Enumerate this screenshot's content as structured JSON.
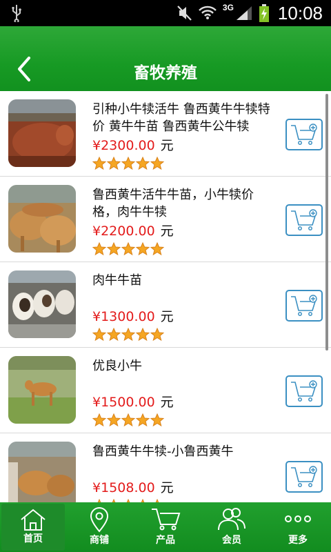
{
  "status_bar": {
    "time": "10:08",
    "network": "3G"
  },
  "header": {
    "title": "畜牧养殖"
  },
  "products": [
    {
      "name": "引种小牛犊活牛 鲁西黄牛牛犊特价 黄牛牛苗 鲁西黄牛公牛犊",
      "price": "¥2300.00",
      "unit": "元",
      "rating": 5
    },
    {
      "name": "鲁西黄牛活牛牛苗，小牛犊价格，肉牛牛犊",
      "price": "¥2200.00",
      "unit": "元",
      "rating": 5
    },
    {
      "name": "肉牛牛苗",
      "price": "¥1300.00",
      "unit": "元",
      "rating": 5
    },
    {
      "name": "优良小牛",
      "price": "¥1500.00",
      "unit": "元",
      "rating": 5
    },
    {
      "name": "鲁西黄牛牛犊-小鲁西黄牛",
      "price": "¥1508.00",
      "unit": "元",
      "rating": 5
    }
  ],
  "nav": {
    "items": [
      {
        "label": "首页",
        "icon": "home-icon"
      },
      {
        "label": "商铺",
        "icon": "location-pin-icon"
      },
      {
        "label": "产品",
        "icon": "cart-icon"
      },
      {
        "label": "会员",
        "icon": "users-icon"
      },
      {
        "label": "更多",
        "icon": "more-dots-icon"
      }
    ],
    "active": 0
  },
  "colors": {
    "header_green": "#179a24",
    "price_red": "#e31b1b",
    "cart_blue": "#3a8fc2",
    "star_orange": "#f5a623"
  }
}
